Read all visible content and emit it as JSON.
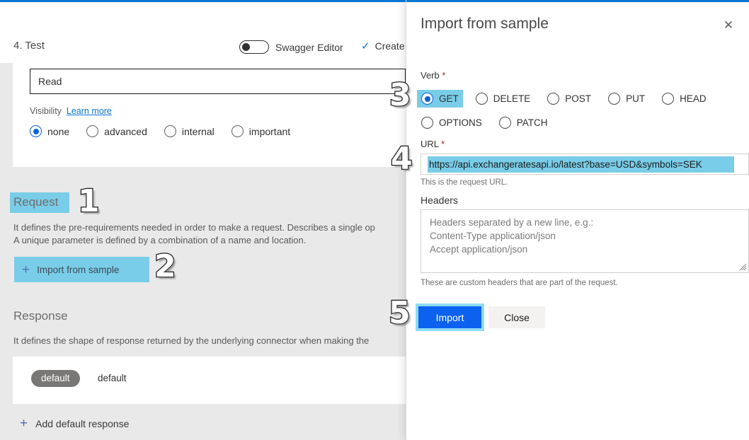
{
  "background": {
    "step_title": "4. Test",
    "swagger_toggle_label": "Swagger Editor",
    "swagger_toggle_state": "off",
    "create_label": "Create",
    "check_icon": "✓",
    "operation_name_value": "Read",
    "visibility_label": "Visibility",
    "visibility_learn_more": "Learn more",
    "visibility_options": [
      {
        "label": "none",
        "selected": true
      },
      {
        "label": "advanced",
        "selected": false
      },
      {
        "label": "internal",
        "selected": false
      },
      {
        "label": "important",
        "selected": false
      }
    ],
    "request_section": {
      "title": "Request",
      "description_line1": "It defines the pre-requirements needed in order to make a request. Describes a single op",
      "description_line2": "A unique parameter is defined by a combination of a name and location.",
      "import_button_label": "Import from sample",
      "plus_icon": "+"
    },
    "response_section": {
      "title": "Response",
      "description": "It defines the shape of response returned by the underlying connector when making the",
      "row_pill": "default",
      "row_name": "default",
      "add_label": "Add default response",
      "plus_icon": "+"
    }
  },
  "panel": {
    "title": "Import from sample",
    "close_icon": "✕",
    "verb": {
      "label": "Verb",
      "required_mark": "*",
      "row1": [
        {
          "label": "GET",
          "selected": true,
          "highlighted": true
        },
        {
          "label": "DELETE",
          "selected": false,
          "highlighted": false
        },
        {
          "label": "POST",
          "selected": false,
          "highlighted": false
        },
        {
          "label": "PUT",
          "selected": false,
          "highlighted": false
        },
        {
          "label": "HEAD",
          "selected": false,
          "highlighted": false
        }
      ],
      "row2": [
        {
          "label": "OPTIONS",
          "selected": false,
          "highlighted": false
        },
        {
          "label": "PATCH",
          "selected": false,
          "highlighted": false
        }
      ]
    },
    "url": {
      "label": "URL",
      "required_mark": "*",
      "value": "https://api.exchangeratesapi.io/latest?base=USD&symbols=SEK",
      "hint": "This is the request URL."
    },
    "headers": {
      "label": "Headers",
      "placeholder": "Headers separated by a new line, e.g.:\nContent-Type application/json\nAccept application/json",
      "value": "",
      "hint": "These are custom headers that are part of the request."
    },
    "actions": {
      "import_label": "Import",
      "close_label": "Close"
    }
  },
  "annotations": {
    "markers": [
      "1",
      "2",
      "3",
      "4",
      "5"
    ]
  },
  "colors": {
    "accent_blue": "#0a78d4",
    "primary_button": "#0c62ef",
    "highlight": "#79cde8",
    "highlight_soft": "#8fdcf5",
    "required_red": "#a4262c",
    "pill_gray": "#797775"
  }
}
